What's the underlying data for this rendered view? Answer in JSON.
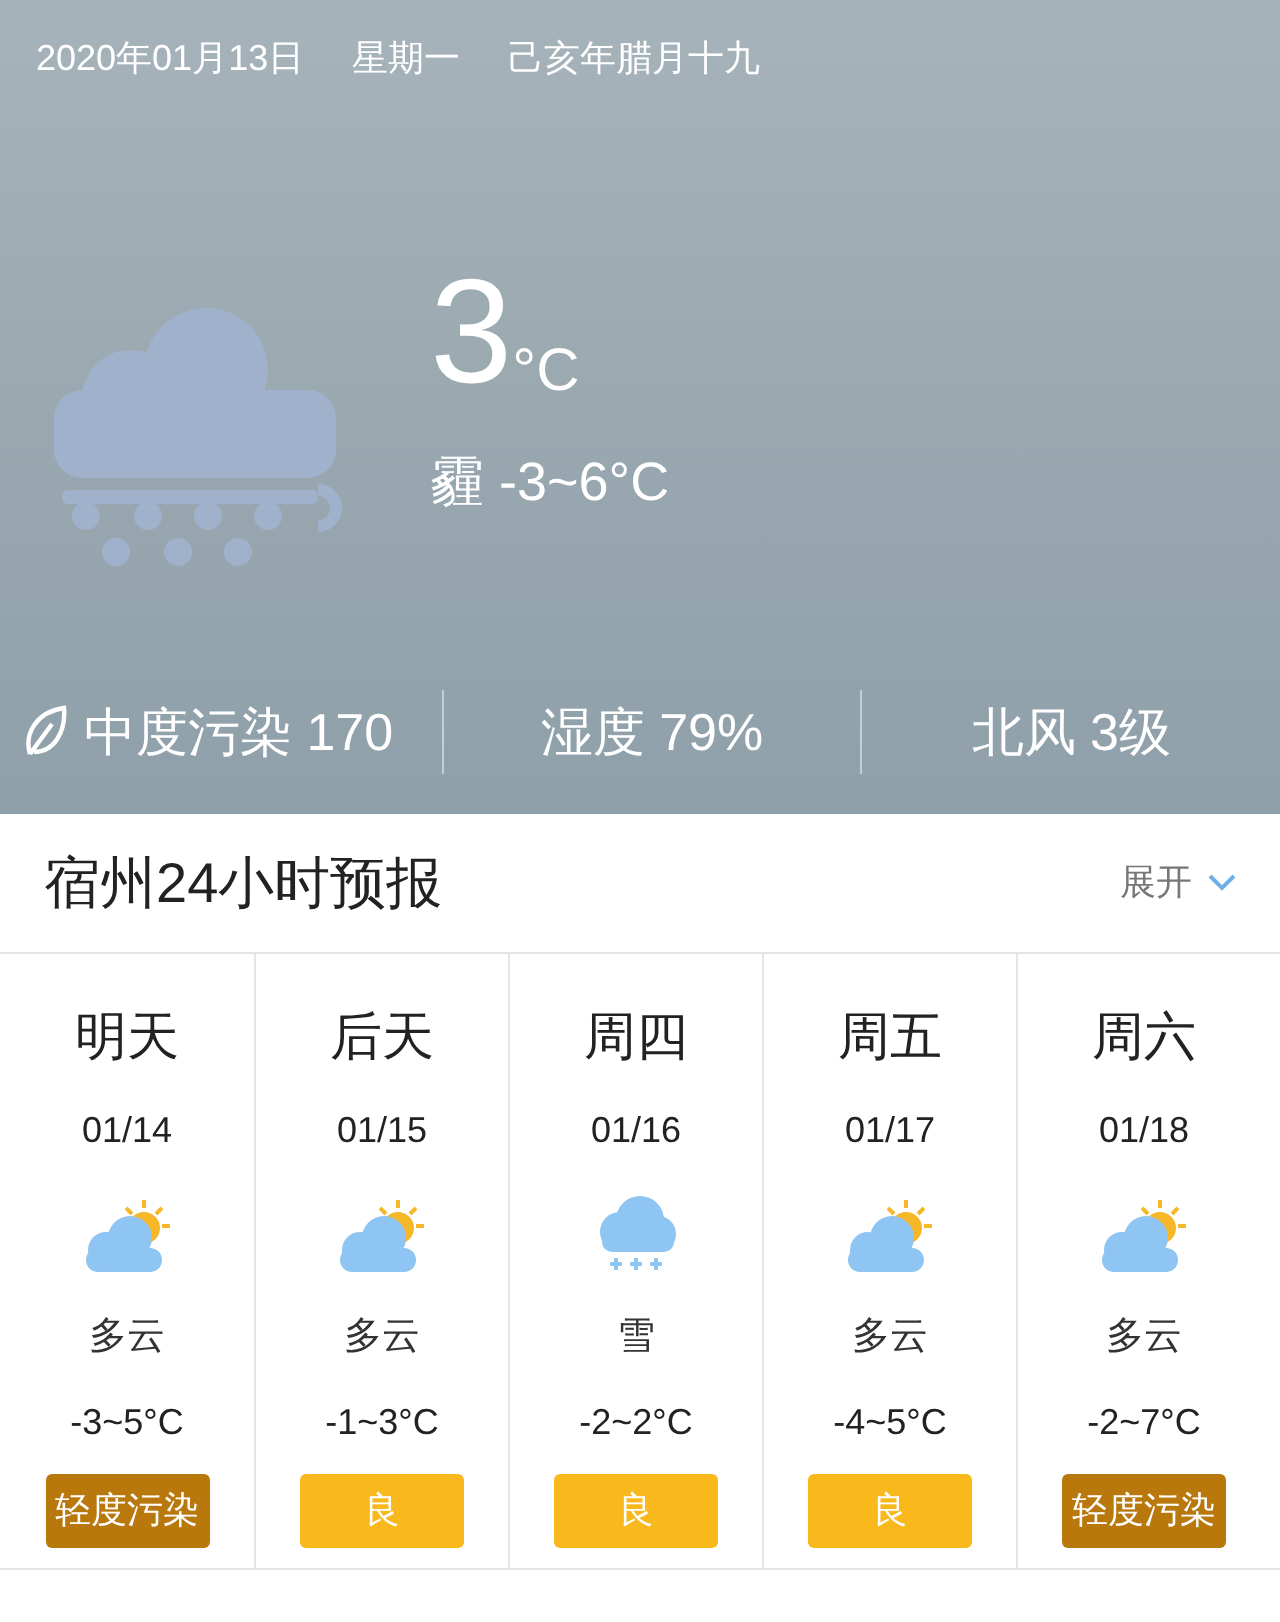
{
  "header": {
    "date": "2020年01月13日",
    "weekday": "星期一",
    "lunar": "己亥年腊月十九"
  },
  "current": {
    "temperature": "3",
    "unit": "°C",
    "condition": "霾 -3~6°C"
  },
  "stats": [
    {
      "kind": "air",
      "text": "中度污染 170"
    },
    {
      "kind": "plain",
      "text": "湿度 79%"
    },
    {
      "kind": "plain",
      "text": "北风 3级"
    }
  ],
  "forecast": {
    "title": "宿州24小时预报",
    "expand": "展开",
    "days": [
      {
        "day": "明天",
        "date": "01/14",
        "kind": "cloudy",
        "desc": "多云",
        "temp": "-3~5°C",
        "aqi": "轻度污染",
        "color": "#b8780c"
      },
      {
        "day": "后天",
        "date": "01/15",
        "kind": "cloudy",
        "desc": "多云",
        "temp": "-1~3°C",
        "aqi": "良",
        "color": "#f9b81b"
      },
      {
        "day": "周四",
        "date": "01/16",
        "kind": "snow",
        "desc": "雪",
        "temp": "-2~2°C",
        "aqi": "良",
        "color": "#f9b81b"
      },
      {
        "day": "周五",
        "date": "01/17",
        "kind": "cloudy",
        "desc": "多云",
        "temp": "-4~5°C",
        "aqi": "良",
        "color": "#f9b81b"
      },
      {
        "day": "周六",
        "date": "01/18",
        "kind": "cloudy",
        "desc": "多云",
        "temp": "-2~7°C",
        "aqi": "轻度污染",
        "color": "#b8780c"
      }
    ]
  }
}
